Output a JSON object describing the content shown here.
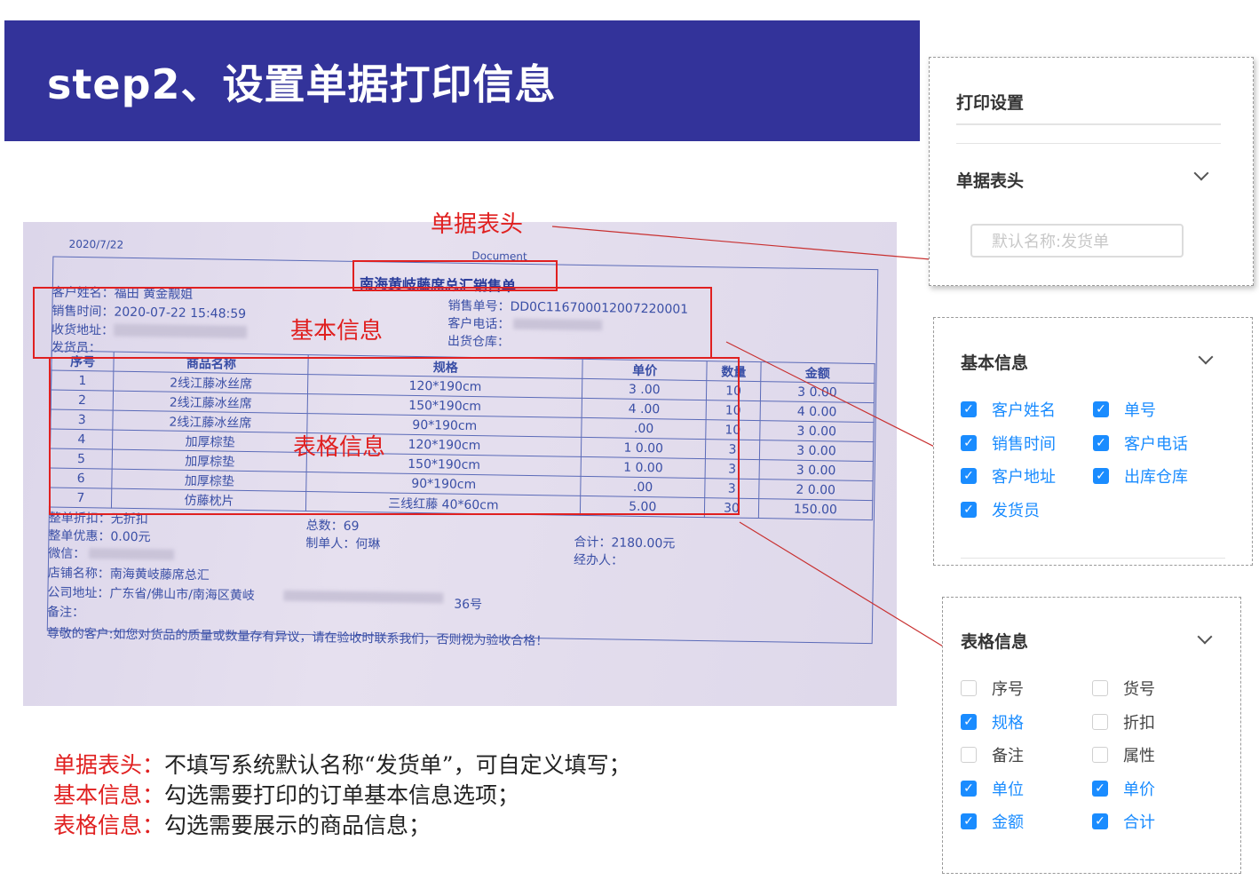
{
  "header": {
    "title": "step2、设置单据打印信息"
  },
  "receipt": {
    "date": "2020/7/22",
    "doc_label": "Document",
    "title": "南海黄岐藤席总汇销售单",
    "customer_name_label": "客户姓名：福田 黄金靓姐",
    "sale_time_label": "销售时间：2020-07-22 15:48:59",
    "address_label": "收货地址：",
    "shipper_label": "发货员：",
    "order_no_label": "销售单号：DD0C116700012007220001",
    "phone_label": "客户电话：",
    "warehouse_label": "出货仓库：",
    "columns": [
      "序号",
      "商品名称",
      "规格",
      "单价",
      "数量",
      "金额"
    ],
    "rows": [
      [
        "1",
        "2线江藤冰丝席",
        "120*190cm",
        "3 .00",
        "10",
        "3 0.00"
      ],
      [
        "2",
        "2线江藤冰丝席",
        "150*190cm",
        "4 .00",
        "10",
        "4 0.00"
      ],
      [
        "3",
        "2线江藤冰丝席",
        "90*190cm",
        " .00",
        "10",
        "3 0.00"
      ],
      [
        "4",
        "加厚棕垫",
        "120*190cm",
        "1 0.00",
        "3",
        "3 0.00"
      ],
      [
        "5",
        "加厚棕垫",
        "150*190cm",
        "1 0.00",
        "3",
        "3 0.00"
      ],
      [
        "6",
        "加厚棕垫",
        "90*190cm",
        ".00",
        "3",
        "2 0.00"
      ],
      [
        "7",
        "仿藤枕片",
        "三线红藤 40*60cm",
        "5.00",
        "30",
        "150.00"
      ]
    ],
    "discount_label": "整单折扣：无折扣",
    "coupon_label": "整单优惠：0.00元",
    "wechat_label": "微信：",
    "total_count_label": "总数：69",
    "maker_label": "制单人：何琳",
    "total_amount_label": "合计：2180.00元",
    "handler_label": "经办人：",
    "shop_label": "店铺名称：南海黄岐藤席总汇",
    "company_addr_label": "公司地址：广东省/佛山市/南海区黄岐",
    "company_addr_tail": "36号",
    "remark_label": "备注：",
    "footer_note": "尊敬的客户:如您对货品的质量或数量存有异议，请在验收时联系我们，否则视为验收合格！"
  },
  "annotations": {
    "header_label": "单据表头",
    "basic_label": "基本信息",
    "table_label": "表格信息"
  },
  "print_settings": {
    "title": "打印设置",
    "header_section": "单据表头",
    "header_placeholder": "默认名称:发货单"
  },
  "basic_info": {
    "title": "基本信息",
    "options": [
      {
        "label": "客户姓名",
        "checked": true
      },
      {
        "label": "单号",
        "checked": true
      },
      {
        "label": "销售时间",
        "checked": true
      },
      {
        "label": "客户电话",
        "checked": true
      },
      {
        "label": "客户地址",
        "checked": true
      },
      {
        "label": "出库仓库",
        "checked": true
      },
      {
        "label": "发货员",
        "checked": true
      }
    ]
  },
  "table_info": {
    "title": "表格信息",
    "options": [
      {
        "label": "序号",
        "checked": false
      },
      {
        "label": "货号",
        "checked": false
      },
      {
        "label": "规格",
        "checked": true
      },
      {
        "label": "折扣",
        "checked": false
      },
      {
        "label": "备注",
        "checked": false
      },
      {
        "label": "属性",
        "checked": false
      },
      {
        "label": "单位",
        "checked": true
      },
      {
        "label": "单价",
        "checked": true
      },
      {
        "label": "金额",
        "checked": true
      },
      {
        "label": "合计",
        "checked": true
      }
    ]
  },
  "notes": [
    {
      "key": "单据表头：",
      "text": "不填写系统默认名称“发货单”，可自定义填写；"
    },
    {
      "key": "基本信息：",
      "text": "勾选需要打印的订单基本信息选项；"
    },
    {
      "key": "表格信息：",
      "text": "勾选需要展示的商品信息；"
    }
  ],
  "colors": {
    "accent": "#1a8cff",
    "banner": "#33339a",
    "annotation": "#e02020"
  }
}
